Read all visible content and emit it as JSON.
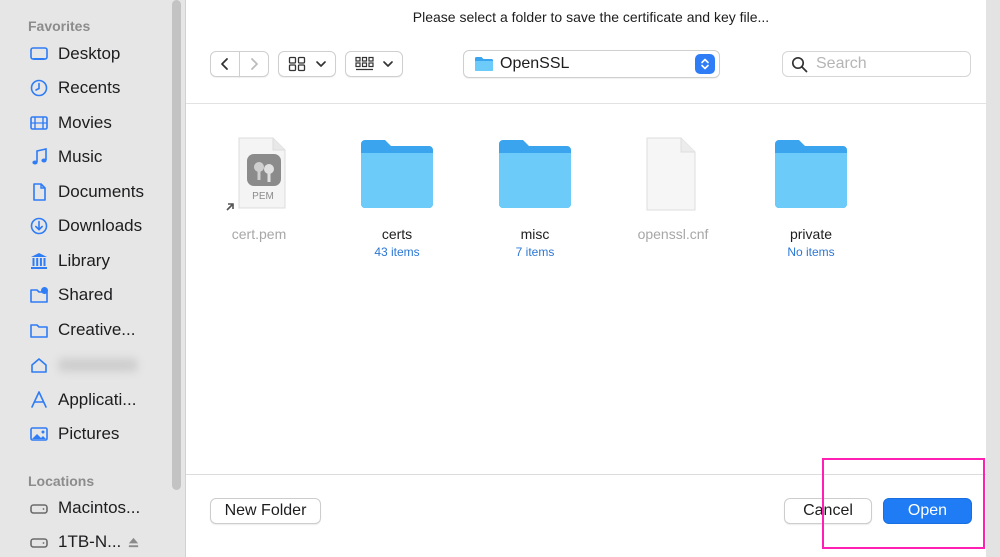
{
  "dialog": {
    "prompt": "Please select a folder to save the certificate and key file...",
    "path": "OpenSSL",
    "search_placeholder": "Search"
  },
  "sidebar": {
    "favorites_title": "Favorites",
    "favorites": [
      {
        "label": "Desktop",
        "icon": "desktop-icon"
      },
      {
        "label": "Recents",
        "icon": "clock-icon"
      },
      {
        "label": "Movies",
        "icon": "film-icon"
      },
      {
        "label": "Music",
        "icon": "music-note-icon"
      },
      {
        "label": "Documents",
        "icon": "document-icon"
      },
      {
        "label": "Downloads",
        "icon": "download-icon"
      },
      {
        "label": "Library",
        "icon": "library-icon"
      },
      {
        "label": "Shared",
        "icon": "shared-folder-icon"
      },
      {
        "label": "Creative...",
        "icon": "folder-icon"
      },
      {
        "label": "",
        "icon": "home-icon"
      },
      {
        "label": "Applicati...",
        "icon": "applications-icon"
      },
      {
        "label": "Pictures",
        "icon": "pictures-icon"
      }
    ],
    "locations_title": "Locations",
    "locations": [
      {
        "label": "Macintos...",
        "icon": "drive-icon"
      },
      {
        "label": "1TB-N...",
        "icon": "drive-icon"
      }
    ]
  },
  "files": [
    {
      "name": "cert.pem",
      "sub": "",
      "kind": "pem-alias",
      "badge": "PEM"
    },
    {
      "name": "certs",
      "sub": "43 items",
      "kind": "folder"
    },
    {
      "name": "misc",
      "sub": "7 items",
      "kind": "folder"
    },
    {
      "name": "openssl.cnf",
      "sub": "",
      "kind": "document"
    },
    {
      "name": "private",
      "sub": "No items",
      "kind": "folder"
    }
  ],
  "buttons": {
    "new_folder": "New Folder",
    "cancel": "Cancel",
    "open": "Open"
  },
  "colors": {
    "accent": "#1f7cf5",
    "highlight": "#ff1fb4",
    "folder": "#5bbdf2"
  }
}
